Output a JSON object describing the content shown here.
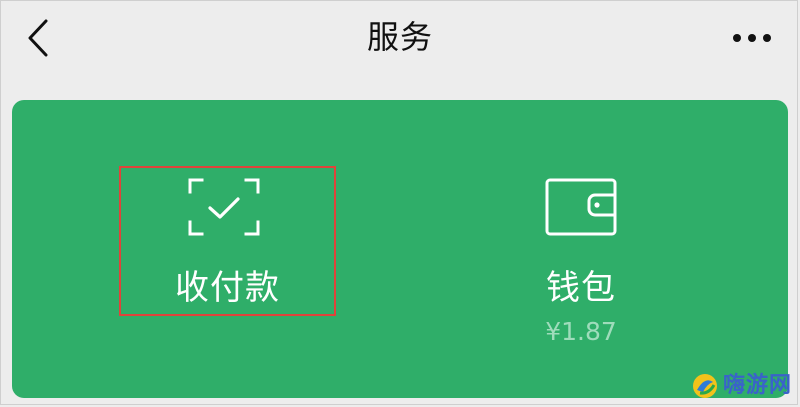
{
  "nav": {
    "title": "服务",
    "back_icon": "chevron-left-icon",
    "more_icon": "more-dots-icon"
  },
  "services": {
    "pay": {
      "label": "收付款",
      "icon": "scan-check-icon",
      "highlighted": true
    },
    "wallet": {
      "label": "钱包",
      "balance": "¥1.87",
      "icon": "wallet-icon"
    }
  },
  "watermark": {
    "text": "嗨游网"
  },
  "colors": {
    "card_green": "#2fae69",
    "highlight_red": "#e0433a",
    "balance_text": "#9fdcbb",
    "watermark_blue": "#3a63c9",
    "background": "#ededed"
  }
}
